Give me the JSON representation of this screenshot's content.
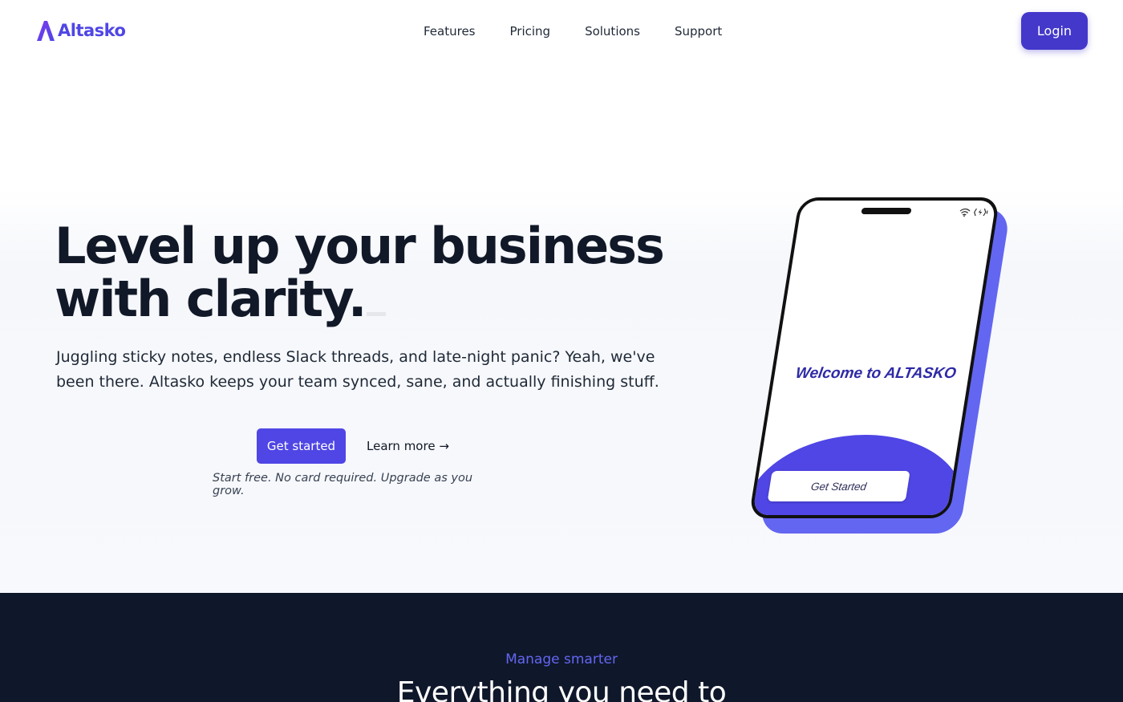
{
  "brand": {
    "name": "Altasko",
    "accent": "#4f46e5",
    "dark_bg": "#0f172a"
  },
  "nav": {
    "links": [
      "Features",
      "Pricing",
      "Solutions",
      "Support"
    ],
    "login_label": "Login"
  },
  "hero": {
    "title_line1": "Level up your business",
    "title_line2": "with clarity.",
    "subtitle": "Juggling sticky notes, endless Slack threads, and late-night panic? Yeah, we've been there. Altasko keeps your team synced, sane, and actually finishing stuff.",
    "primary_cta": "Get started",
    "secondary_cta": "Learn more →",
    "note": "Start free. No card required. Upgrade as you grow."
  },
  "phone": {
    "welcome": "Welcome to ALTASKO",
    "button": "Get Started",
    "status_icons": [
      "wifi-icon",
      "battery-icon"
    ]
  },
  "features": {
    "eyebrow": "Manage smarter",
    "title": "Everything you need to"
  }
}
